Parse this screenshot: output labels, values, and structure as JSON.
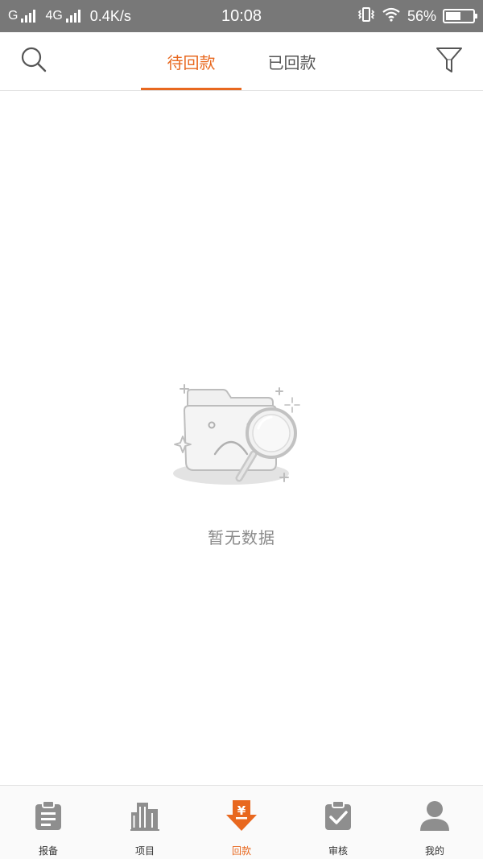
{
  "status_bar": {
    "carrier_1": "G",
    "carrier_2": "4G",
    "speed": "0.4K/s",
    "time": "10:08",
    "battery": "56%",
    "battery_level": 0.56,
    "icons": [
      "signal-icon",
      "vibrate-icon",
      "wifi-icon",
      "battery-icon"
    ]
  },
  "header": {
    "search_icon": "search-icon",
    "filter_icon": "filter-icon",
    "tabs": [
      {
        "label": "待回款",
        "active": true
      },
      {
        "label": "已回款",
        "active": false
      }
    ]
  },
  "empty_state": {
    "icon": "empty-folder-search-icon",
    "text": "暂无数据"
  },
  "colors": {
    "accent": "#e8681f",
    "status_bar": "#787878",
    "icon_gray": "#8e8e8e"
  },
  "bottom_nav": {
    "items": [
      {
        "label": "报备",
        "icon": "clipboard-icon",
        "active": false
      },
      {
        "label": "项目",
        "icon": "building-icon",
        "active": false
      },
      {
        "label": "回款",
        "icon": "yuan-download-icon",
        "active": true
      },
      {
        "label": "审核",
        "icon": "clipboard-check-icon",
        "active": false
      },
      {
        "label": "我的",
        "icon": "user-icon",
        "active": false
      }
    ]
  }
}
